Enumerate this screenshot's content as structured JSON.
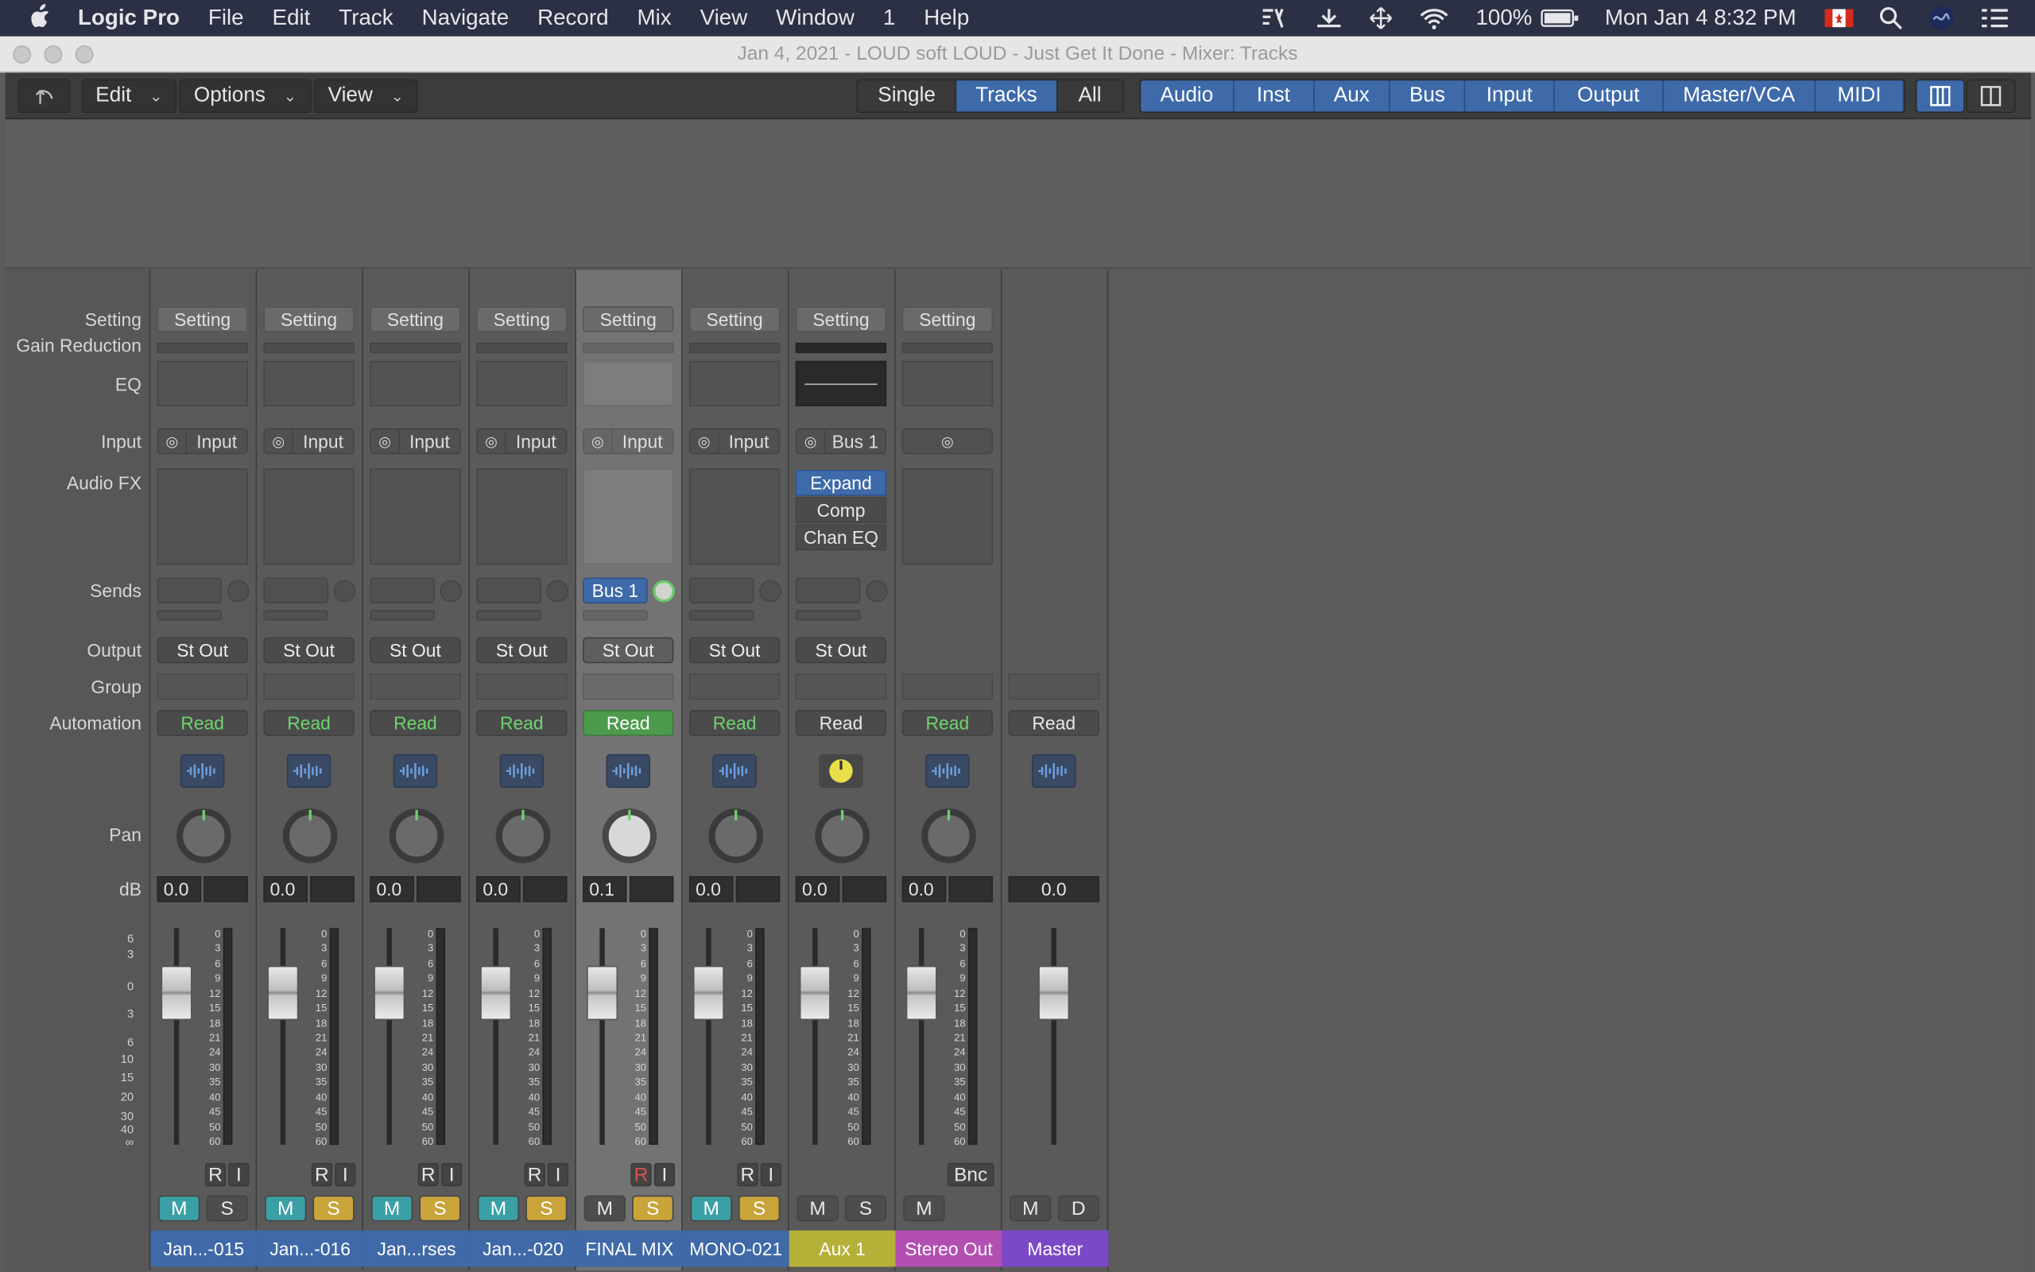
{
  "menubar": {
    "app": "Logic Pro",
    "items": [
      "File",
      "Edit",
      "Track",
      "Navigate",
      "Record",
      "Mix",
      "View",
      "Window",
      "1",
      "Help"
    ],
    "battery": "100%",
    "datetime": "Mon Jan 4  8:32 PM"
  },
  "window": {
    "title": "Jan 4, 2021 - LOUD soft LOUD - Just Get It Done - Mixer: Tracks"
  },
  "toolbar": {
    "edit": "Edit",
    "options": "Options",
    "view": "View",
    "view_modes": [
      "Single",
      "Tracks",
      "All"
    ],
    "active_view_mode": "Tracks",
    "filters": [
      "Audio",
      "Inst",
      "Aux",
      "Bus",
      "Input",
      "Output",
      "Master/VCA",
      "MIDI"
    ]
  },
  "row_labels": {
    "setting": "Setting",
    "gain_reduction": "Gain Reduction",
    "eq": "EQ",
    "input": "Input",
    "audio_fx": "Audio FX",
    "sends": "Sends",
    "output": "Output",
    "group": "Group",
    "automation": "Automation",
    "pan": "Pan",
    "db": "dB"
  },
  "fader_scale": [
    "6",
    "3",
    "0",
    "3",
    "6",
    "10",
    "15",
    "20",
    "30",
    "40",
    "∞"
  ],
  "meter_scale": [
    "0",
    "3",
    "6",
    "9",
    "12",
    "15",
    "18",
    "21",
    "24",
    "30",
    "35",
    "40",
    "45",
    "50",
    "60"
  ],
  "colors": {
    "accent_blue": "#3e6aaa",
    "read_green": "#6ed46e",
    "mute_teal": "#3aa0a5",
    "solo_yellow": "#c8a43a",
    "audio_name_bg": "#3f69a8",
    "aux_name_bg": "#b5b038",
    "stereo_out_bg": "#b34fb3",
    "master_bg": "#7b48c8"
  },
  "strips": [
    {
      "name": "Jan...-015",
      "setting": "Setting",
      "input": "Input",
      "output": "St Out",
      "automation": "Read",
      "db": "0.0",
      "mute": "M",
      "solo": "S",
      "rec": "R",
      "inmon": "I"
    },
    {
      "name": "Jan...-016",
      "setting": "Setting",
      "input": "Input",
      "output": "St Out",
      "automation": "Read",
      "db": "0.0",
      "mute": "M",
      "solo": "S",
      "rec": "R",
      "inmon": "I"
    },
    {
      "name": "Jan...rses",
      "setting": "Setting",
      "input": "Input",
      "output": "St Out",
      "automation": "Read",
      "db": "0.0",
      "mute": "M",
      "solo": "S",
      "rec": "R",
      "inmon": "I"
    },
    {
      "name": "Jan...-020",
      "setting": "Setting",
      "input": "Input",
      "output": "St Out",
      "automation": "Read",
      "db": "0.0",
      "mute": "M",
      "solo": "S",
      "rec": "R",
      "inmon": "I"
    },
    {
      "name": "FINAL MIX",
      "setting": "Setting",
      "input": "Input",
      "send": "Bus 1",
      "output": "St Out",
      "automation": "Read",
      "db": "0.1",
      "mute": "M",
      "solo": "S",
      "rec": "R",
      "inmon": "I"
    },
    {
      "name": "MONO-021",
      "setting": "Setting",
      "input": "Input",
      "output": "St Out",
      "automation": "Read",
      "db": "0.0",
      "mute": "M",
      "solo": "S",
      "rec": "R",
      "inmon": "I"
    },
    {
      "name": "Aux 1",
      "setting": "Setting",
      "input": "Bus 1",
      "fx": [
        "Expand",
        "Comp",
        "Chan EQ"
      ],
      "output": "St Out",
      "automation": "Read",
      "db": "0.0",
      "mute": "M",
      "solo": "S"
    },
    {
      "name": "Stereo Out",
      "setting": "Setting",
      "automation": "Read",
      "db": "0.0",
      "mute": "M",
      "bounce": "Bnc"
    },
    {
      "name": "Master",
      "automation": "Read",
      "db": "0.0",
      "mute": "M",
      "dim": "D"
    }
  ]
}
